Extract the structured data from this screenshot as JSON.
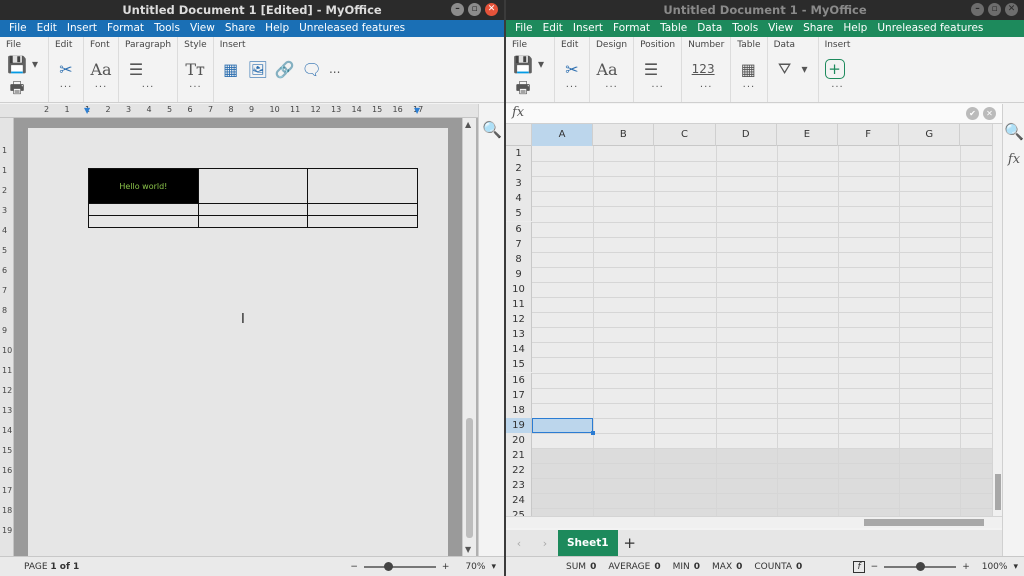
{
  "doc": {
    "title": "Untitled Document 1 [Edited] - MyOffice",
    "menu": [
      "File",
      "Edit",
      "Insert",
      "Format",
      "Tools",
      "View",
      "Share",
      "Help",
      "Unreleased features"
    ],
    "groups": {
      "file": "File",
      "edit": "Edit",
      "font": "Font",
      "paragraph": "Paragraph",
      "style": "Style",
      "insert": "Insert"
    },
    "more": "···",
    "insert_more": "...",
    "ruler_h": [
      "2",
      "1",
      "1",
      "2",
      "3",
      "4",
      "5",
      "6",
      "7",
      "8",
      "9",
      "10",
      "11",
      "12",
      "13",
      "14",
      "15",
      "16",
      "17"
    ],
    "ruler_v": [
      "1",
      "1",
      "2",
      "3",
      "4",
      "5",
      "6",
      "7",
      "8",
      "9",
      "10",
      "11",
      "12",
      "13",
      "14",
      "15",
      "16",
      "17",
      "18",
      "19"
    ],
    "table_cell_text": "Hello world!",
    "status": {
      "page_prefix": "PAGE",
      "page_current": "1 of 1",
      "zoom": "70%",
      "zoom_fraction": 0.33
    }
  },
  "sheet": {
    "title": "Untitled Document 1 - MyOffice",
    "menu": [
      "File",
      "Edit",
      "Insert",
      "Format",
      "Table",
      "Data",
      "Tools",
      "View",
      "Share",
      "Help",
      "Unreleased features"
    ],
    "groups": {
      "file": "File",
      "edit": "Edit",
      "design": "Design",
      "position": "Position",
      "number": "Number",
      "table": "Table",
      "data": "Data",
      "insert": "Insert"
    },
    "number_icon": "123",
    "more": "···",
    "columns": [
      "A",
      "B",
      "C",
      "D",
      "E",
      "F",
      "G"
    ],
    "rows": [
      "1",
      "2",
      "3",
      "4",
      "5",
      "6",
      "7",
      "8",
      "9",
      "10",
      "11",
      "12",
      "13",
      "14",
      "15",
      "16",
      "17",
      "18",
      "19",
      "20",
      "21",
      "22",
      "23",
      "24",
      "25"
    ],
    "selected_cell": {
      "column": "A",
      "row": "19"
    },
    "sheet_tab": "Sheet1",
    "status": {
      "sum_label": "SUM",
      "sum": "0",
      "average_label": "AVERAGE",
      "average": "0",
      "min_label": "MIN",
      "min": "0",
      "max_label": "MAX",
      "max": "0",
      "counta_label": "COUNTA",
      "counta": "0",
      "zoom": "100%",
      "zoom_fraction": 0.5
    }
  },
  "colors": {
    "doc_accent": "#1a6fb5",
    "sheet_accent": "#1d8a5c",
    "selection": "#bcd6ec",
    "selection_border": "#2b7cd3"
  }
}
